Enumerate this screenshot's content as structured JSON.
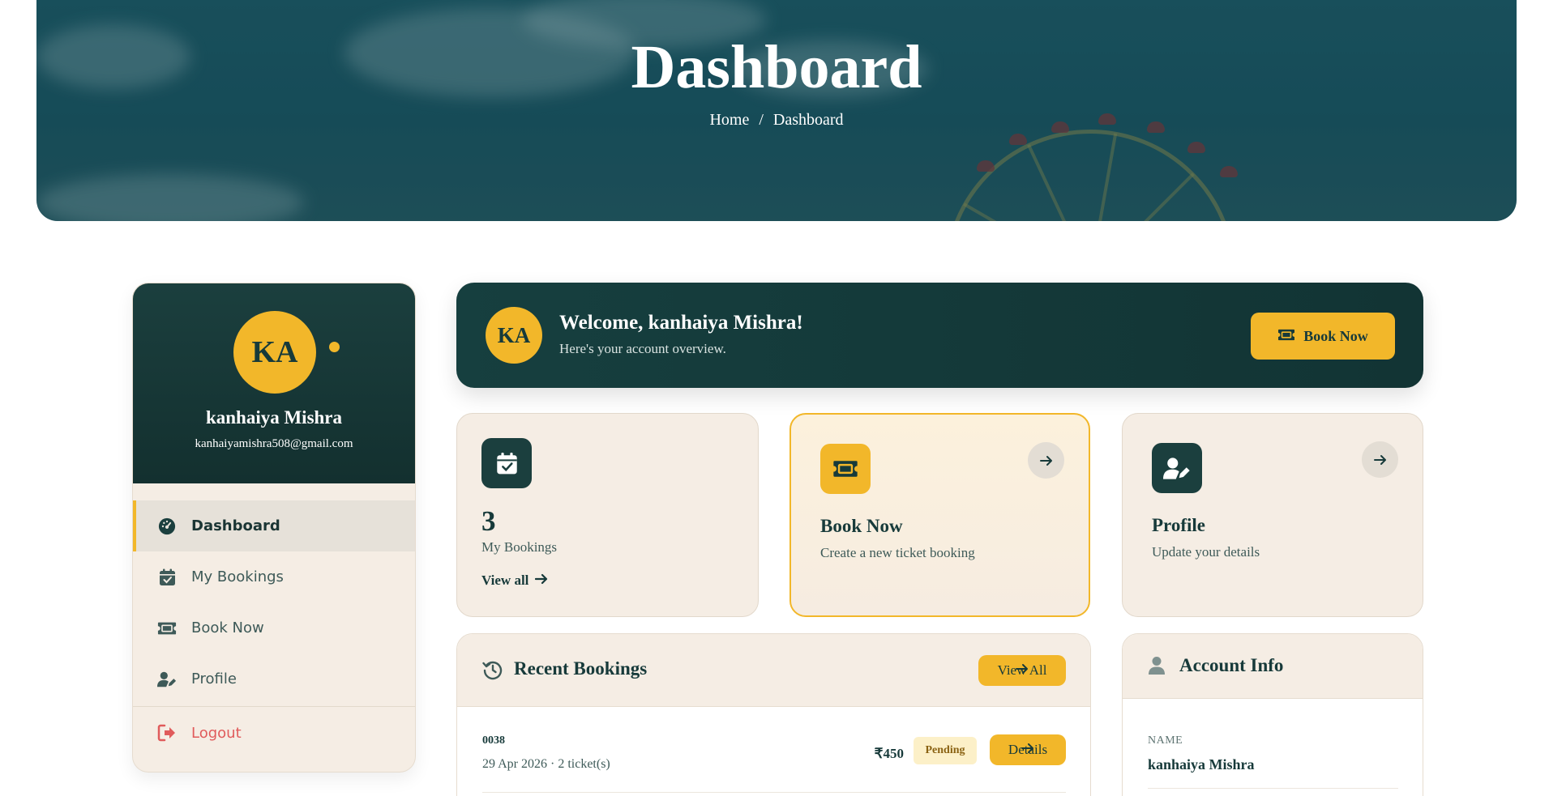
{
  "hero": {
    "title": "Dashboard",
    "breadcrumb": {
      "home": "Home",
      "separator": "/",
      "current": "Dashboard"
    }
  },
  "sidebar": {
    "avatar_initials": "KA",
    "name": "kanhaiya Mishra",
    "email": "kanhaiyamishra508@gmail.com",
    "items": [
      {
        "label": "Dashboard",
        "icon": "dashboard-gauge-icon",
        "active": true
      },
      {
        "label": "My Bookings",
        "icon": "calendar-check-icon",
        "active": false
      },
      {
        "label": "Book Now",
        "icon": "ticket-icon",
        "active": false
      },
      {
        "label": "Profile",
        "icon": "user-edit-icon",
        "active": false
      }
    ],
    "logout_label": "Logout",
    "logout_icon": "logout-icon"
  },
  "welcome": {
    "initials": "KA",
    "title": "Welcome, kanhaiya Mishra!",
    "subtitle": "Here's your account overview.",
    "button_label": "Book Now",
    "button_icon": "ticket-icon"
  },
  "cards": {
    "bookings": {
      "icon": "calendar-check-icon",
      "count": "3",
      "label": "My Bookings",
      "link_label": "View all"
    },
    "book_now": {
      "icon": "ticket-icon",
      "title": "Book Now",
      "description": "Create a new ticket booking"
    },
    "profile": {
      "icon": "user-edit-icon",
      "title": "Profile",
      "description": "Update your details"
    }
  },
  "recent_bookings": {
    "title": "Recent Bookings",
    "view_all_label": "View All",
    "rows": [
      {
        "id": "0038",
        "meta": "29 Apr 2026 · 2 ticket(s)",
        "price": "₹450",
        "status": "Pending",
        "action_label": "Details"
      }
    ]
  },
  "account_info": {
    "title": "Account Info",
    "fields": [
      {
        "label": "NAME",
        "value": "kanhaiya Mishra"
      }
    ]
  },
  "colors": {
    "primary_dark": "#163f3f",
    "accent": "#f2b72a",
    "card_bg": "#f5ede4",
    "logout_red": "#e05b5b"
  }
}
